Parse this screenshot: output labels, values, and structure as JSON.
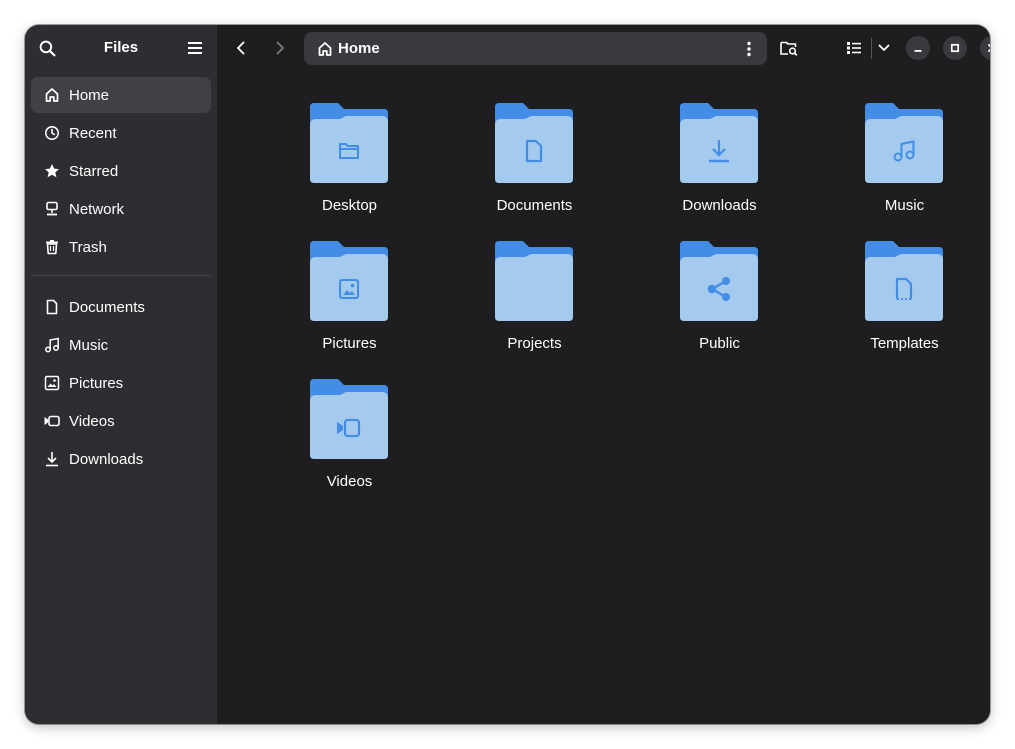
{
  "sidebar": {
    "title": "Files",
    "items": [
      {
        "label": "Home",
        "icon": "home-icon",
        "active": true
      },
      {
        "label": "Recent",
        "icon": "clock-icon"
      },
      {
        "label": "Starred",
        "icon": "star-icon"
      },
      {
        "label": "Network",
        "icon": "network-icon"
      },
      {
        "label": "Trash",
        "icon": "trash-icon"
      }
    ],
    "bookmarks": [
      {
        "label": "Documents",
        "icon": "document-icon"
      },
      {
        "label": "Music",
        "icon": "music-icon"
      },
      {
        "label": "Pictures",
        "icon": "picture-icon"
      },
      {
        "label": "Videos",
        "icon": "video-icon"
      },
      {
        "label": "Downloads",
        "icon": "download-icon"
      }
    ]
  },
  "pathbar": {
    "location": "Home"
  },
  "folders": [
    {
      "name": "Desktop",
      "emblem": "folder"
    },
    {
      "name": "Documents",
      "emblem": "document"
    },
    {
      "name": "Downloads",
      "emblem": "download"
    },
    {
      "name": "Music",
      "emblem": "music"
    },
    {
      "name": "Pictures",
      "emblem": "picture"
    },
    {
      "name": "Projects",
      "emblem": "none"
    },
    {
      "name": "Public",
      "emblem": "share"
    },
    {
      "name": "Templates",
      "emblem": "template"
    },
    {
      "name": "Videos",
      "emblem": "video"
    }
  ],
  "colors": {
    "sidebar_bg": "#2e2e32",
    "main_bg": "#1e1e20",
    "folder_back": "#438de6",
    "folder_front": "#a4caee",
    "emblem": "#438de6"
  }
}
